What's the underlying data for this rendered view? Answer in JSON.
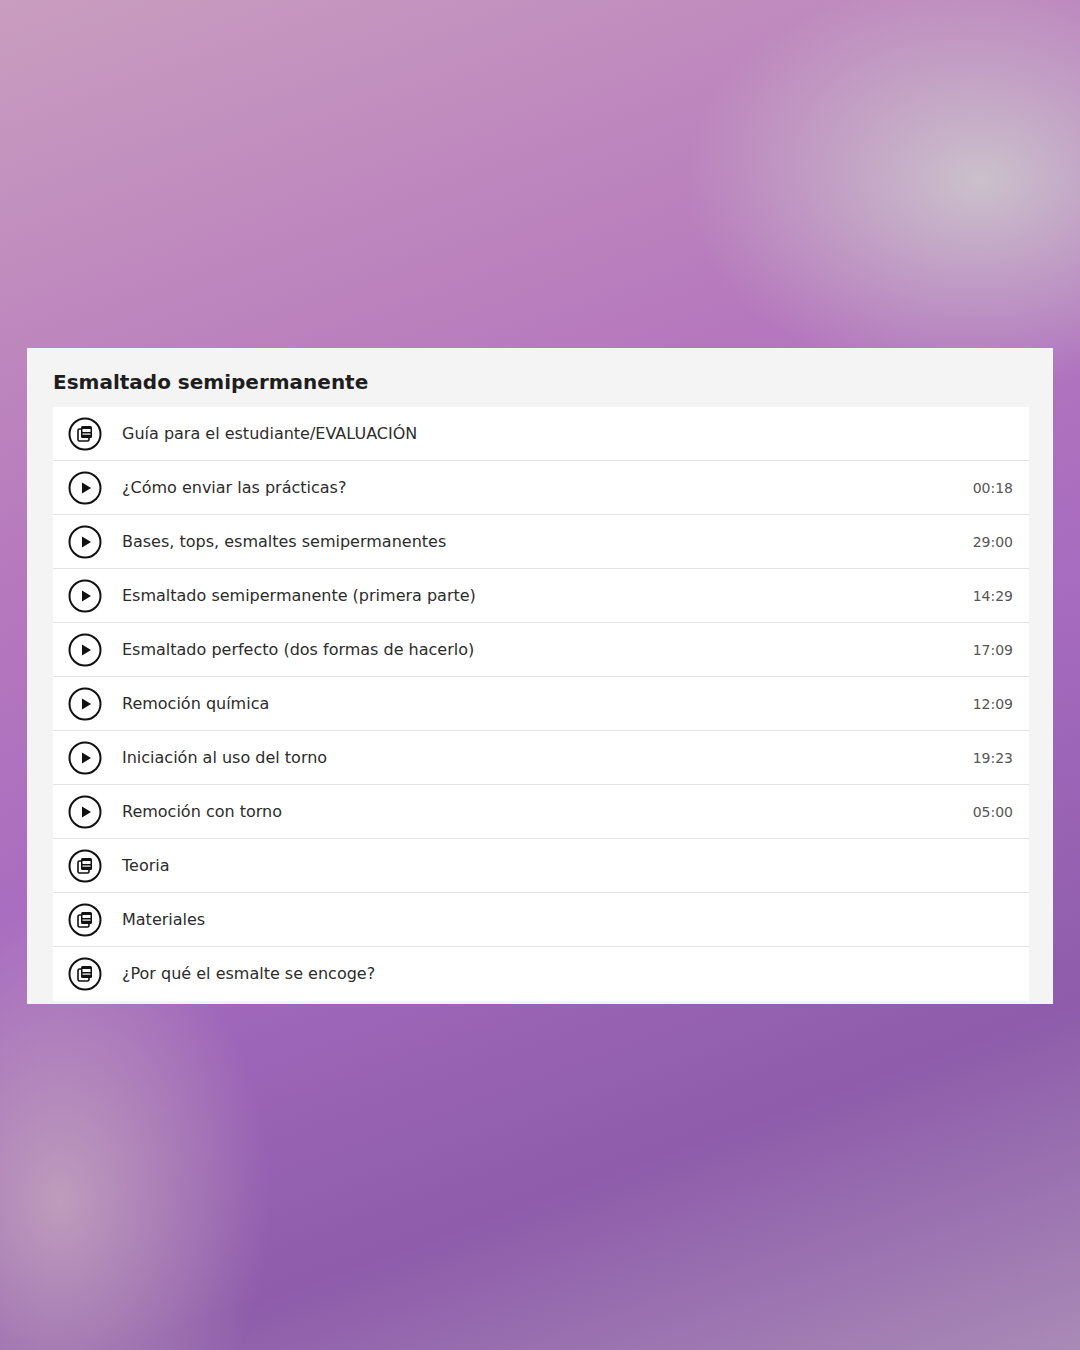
{
  "section": {
    "title": "Esmaltado semipermanente"
  },
  "lessons": [
    {
      "kind": "pdf",
      "label": "Guía para el estudiante/EVALUACIÓN",
      "duration": ""
    },
    {
      "kind": "video",
      "label": "¿Cómo enviar las prácticas?",
      "duration": "00:18"
    },
    {
      "kind": "video",
      "label": "Bases, tops, esmaltes semipermanentes",
      "duration": "29:00"
    },
    {
      "kind": "video",
      "label": "Esmaltado semipermanente (primera parte)",
      "duration": "14:29"
    },
    {
      "kind": "video",
      "label": "Esmaltado perfecto (dos formas de hacerlo)",
      "duration": "17:09"
    },
    {
      "kind": "video",
      "label": "Remoción química",
      "duration": "12:09"
    },
    {
      "kind": "video",
      "label": "Iniciación al uso del torno",
      "duration": "19:23"
    },
    {
      "kind": "video",
      "label": "Remoción con torno",
      "duration": "05:00"
    },
    {
      "kind": "pdf",
      "label": "Teoria",
      "duration": ""
    },
    {
      "kind": "pdf",
      "label": "Materiales",
      "duration": ""
    },
    {
      "kind": "pdf",
      "label": "¿Por qué el esmalte se encoge?",
      "duration": ""
    }
  ]
}
